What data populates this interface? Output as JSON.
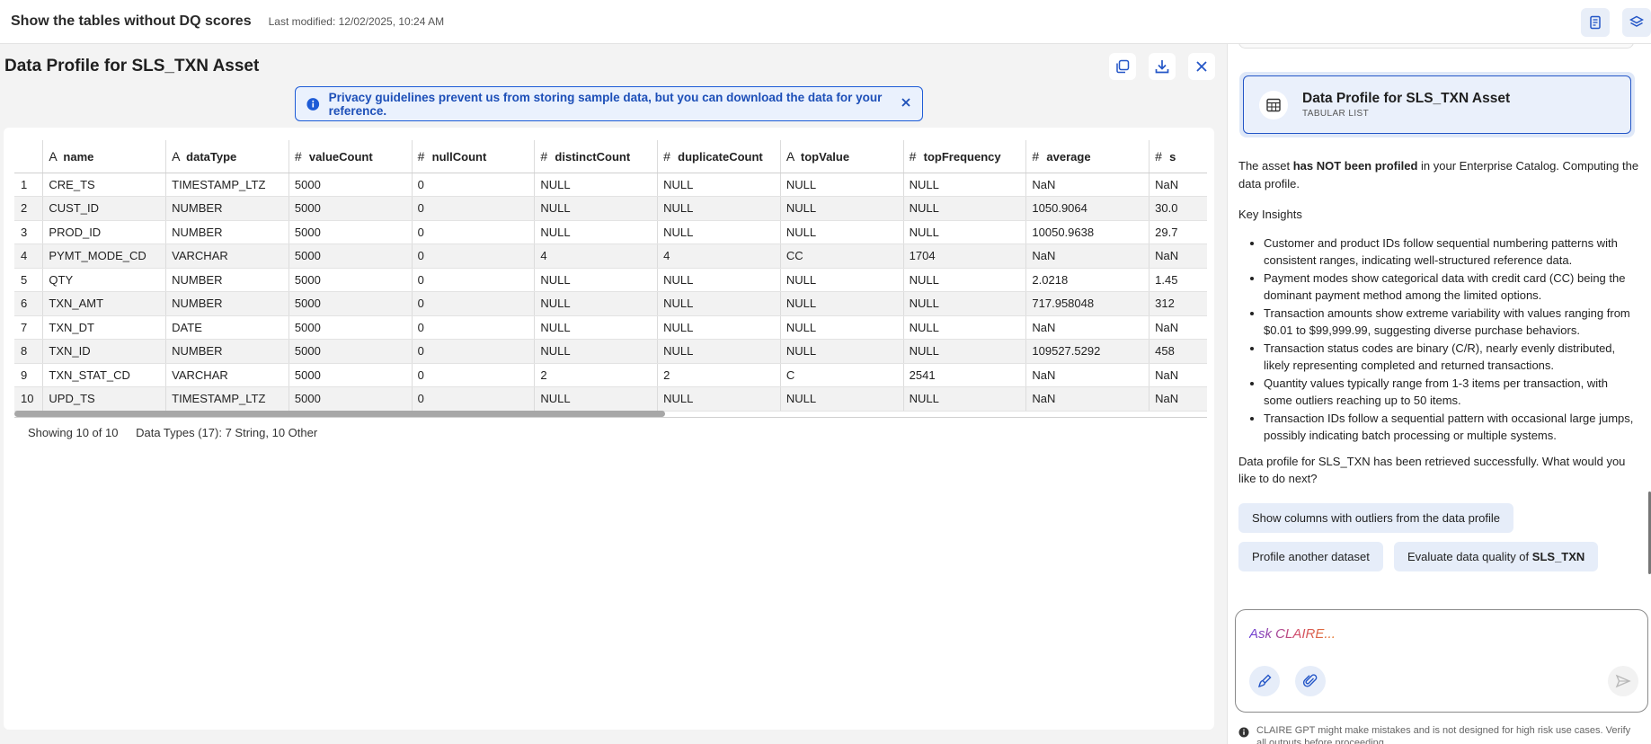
{
  "header": {
    "title": "Show the tables without DQ scores",
    "modified": "Last modified: 12/02/2025, 10:24 AM",
    "icons": [
      "document-icon",
      "layers-icon"
    ]
  },
  "panel": {
    "title": "Data Profile for SLS_TXN Asset",
    "actions": [
      "copy-icon",
      "download-icon",
      "close-icon"
    ]
  },
  "banner": {
    "text": "Privacy guidelines prevent us from storing sample data, but you can download the data for your reference."
  },
  "table": {
    "columns": [
      {
        "type": "A",
        "label": "name"
      },
      {
        "type": "A",
        "label": "dataType"
      },
      {
        "type": "#",
        "label": "valueCount"
      },
      {
        "type": "#",
        "label": "nullCount"
      },
      {
        "type": "#",
        "label": "distinctCount"
      },
      {
        "type": "#",
        "label": "duplicateCount"
      },
      {
        "type": "A",
        "label": "topValue"
      },
      {
        "type": "#",
        "label": "topFrequency"
      },
      {
        "type": "#",
        "label": "average"
      },
      {
        "type": "#",
        "label": "s"
      }
    ],
    "rows": [
      [
        "1",
        "CRE_TS",
        "TIMESTAMP_LTZ",
        "5000",
        "0",
        "NULL",
        "NULL",
        "NULL",
        "NULL",
        "NaN",
        "NaN"
      ],
      [
        "2",
        "CUST_ID",
        "NUMBER",
        "5000",
        "0",
        "NULL",
        "NULL",
        "NULL",
        "NULL",
        "1050.9064",
        "30.0"
      ],
      [
        "3",
        "PROD_ID",
        "NUMBER",
        "5000",
        "0",
        "NULL",
        "NULL",
        "NULL",
        "NULL",
        "10050.9638",
        "29.7"
      ],
      [
        "4",
        "PYMT_MODE_CD",
        "VARCHAR",
        "5000",
        "0",
        "4",
        "4",
        "CC",
        "1704",
        "NaN",
        "NaN"
      ],
      [
        "5",
        "QTY",
        "NUMBER",
        "5000",
        "0",
        "NULL",
        "NULL",
        "NULL",
        "NULL",
        "2.0218",
        "1.45"
      ],
      [
        "6",
        "TXN_AMT",
        "NUMBER",
        "5000",
        "0",
        "NULL",
        "NULL",
        "NULL",
        "NULL",
        "717.958048",
        "312"
      ],
      [
        "7",
        "TXN_DT",
        "DATE",
        "5000",
        "0",
        "NULL",
        "NULL",
        "NULL",
        "NULL",
        "NaN",
        "NaN"
      ],
      [
        "8",
        "TXN_ID",
        "NUMBER",
        "5000",
        "0",
        "NULL",
        "NULL",
        "NULL",
        "NULL",
        "109527.5292",
        "458"
      ],
      [
        "9",
        "TXN_STAT_CD",
        "VARCHAR",
        "5000",
        "0",
        "2",
        "2",
        "C",
        "2541",
        "NaN",
        "NaN"
      ],
      [
        "10",
        "UPD_TS",
        "TIMESTAMP_LTZ",
        "5000",
        "0",
        "NULL",
        "NULL",
        "NULL",
        "NULL",
        "NaN",
        "NaN"
      ]
    ],
    "summary_showing": "Showing 10 of 10",
    "summary_types": "Data Types (17): 7 String, 10 Other"
  },
  "chat": {
    "asset_card": {
      "name": "Data Profile for SLS_TXN Asset",
      "subtitle": "TABULAR LIST",
      "icon": "table-icon"
    },
    "intro_before": "The asset ",
    "intro_bold": "has NOT been profiled",
    "intro_after": " in your Enterprise Catalog. Computing the data profile.",
    "insights_heading": "Key Insights",
    "insights": [
      "Customer and product IDs follow sequential numbering patterns with consistent ranges, indicating well-structured reference data.",
      "Payment modes show categorical data with credit card (CC) being the dominant payment method among the limited options.",
      "Transaction amounts show extreme variability with values ranging from $0.01 to $99,999.99, suggesting diverse purchase behaviors.",
      "Transaction status codes are binary (C/R), nearly evenly distributed, likely representing completed and returned transactions.",
      "Quantity values typically range from 1-3 items per transaction, with some outliers reaching up to 50 items.",
      "Transaction IDs follow a sequential pattern with occasional large jumps, possibly indicating batch processing or multiple systems."
    ],
    "next_text": "Data profile for SLS_TXN has been retrieved successfully. What would you like to do next?",
    "chips": {
      "outliers": "Show columns with outliers from the data profile",
      "profile_another": "Profile another dataset",
      "evaluate_prefix": "Evaluate data quality of ",
      "evaluate_bold": "SLS_TXN"
    },
    "composer_placeholder": "Ask CLAIRE...",
    "composer_icons": [
      "brush-icon",
      "paperclip-icon",
      "send-icon"
    ],
    "disclaimer": "CLAIRE GPT might make mistakes and is not designed for high risk use cases. Verify all outputs before proceeding."
  },
  "colors": {
    "accent": "#1d5bd6",
    "chip_bg": "#e6edf9",
    "banner_bg": "#eaf1fd"
  }
}
